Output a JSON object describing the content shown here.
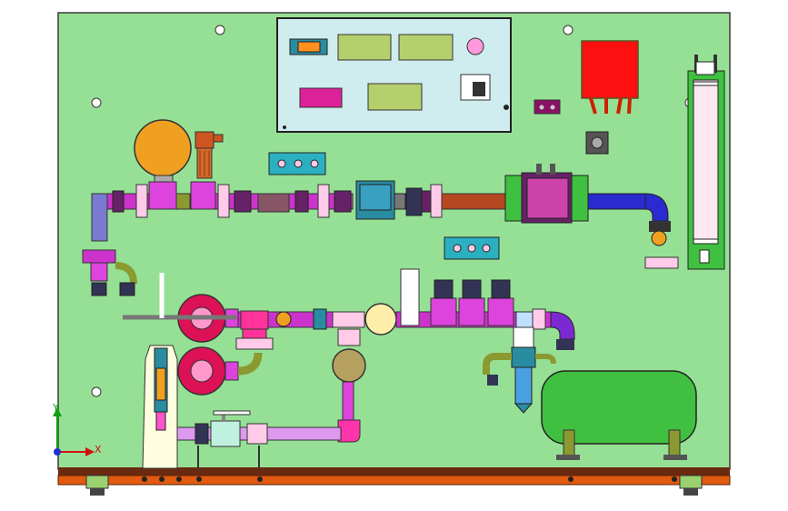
{
  "colors": {
    "board": "#96e096",
    "board_edge": "#3a3a3a",
    "base": "#e05a10",
    "base_dark": "#6a2a10",
    "panel": "#cfecee",
    "display": "#b5cf6c",
    "magenta": "#cc33cc",
    "pink": "#ff55cc",
    "red_device": "#ff1010",
    "blue_pipe": "#2a2ad0",
    "tank_green": "#40c040",
    "gauge_orange": "#f0a020",
    "steel_blue": "#2a8ca0"
  },
  "axis_triad": {
    "x_label": "X",
    "y_label": "Y"
  }
}
